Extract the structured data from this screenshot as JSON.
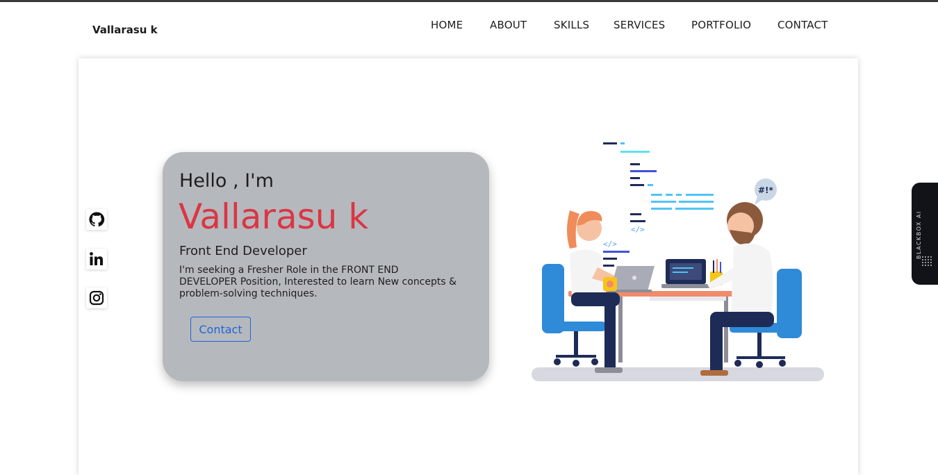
{
  "nav": {
    "brand": "Vallarasu k",
    "links": [
      "HOME",
      "ABOUT",
      "SKILLS",
      "SERVICES",
      "PORTFOLIO",
      "CONTACT"
    ]
  },
  "social": [
    {
      "icon": "github-icon"
    },
    {
      "icon": "linkedin-icon"
    },
    {
      "icon": "instagram-icon"
    }
  ],
  "hero": {
    "greeting": "Hello , I'm",
    "name": "Vallarasu k",
    "role": "Front End Developer",
    "description": "I'm seeking a Fresher Role in the FRONT END DEVELOPER Position, Interested to learn New concepts & problem-solving techniques.",
    "button_label": "Contact"
  },
  "illustration": {
    "speech_bubble": "#!*",
    "code_tag": "</>"
  },
  "extension": {
    "label": "BLACKBOX AI"
  },
  "colors": {
    "accent_red": "#dc3545",
    "card_bg": "#b5b9bd",
    "button_blue": "#1f64d8"
  }
}
